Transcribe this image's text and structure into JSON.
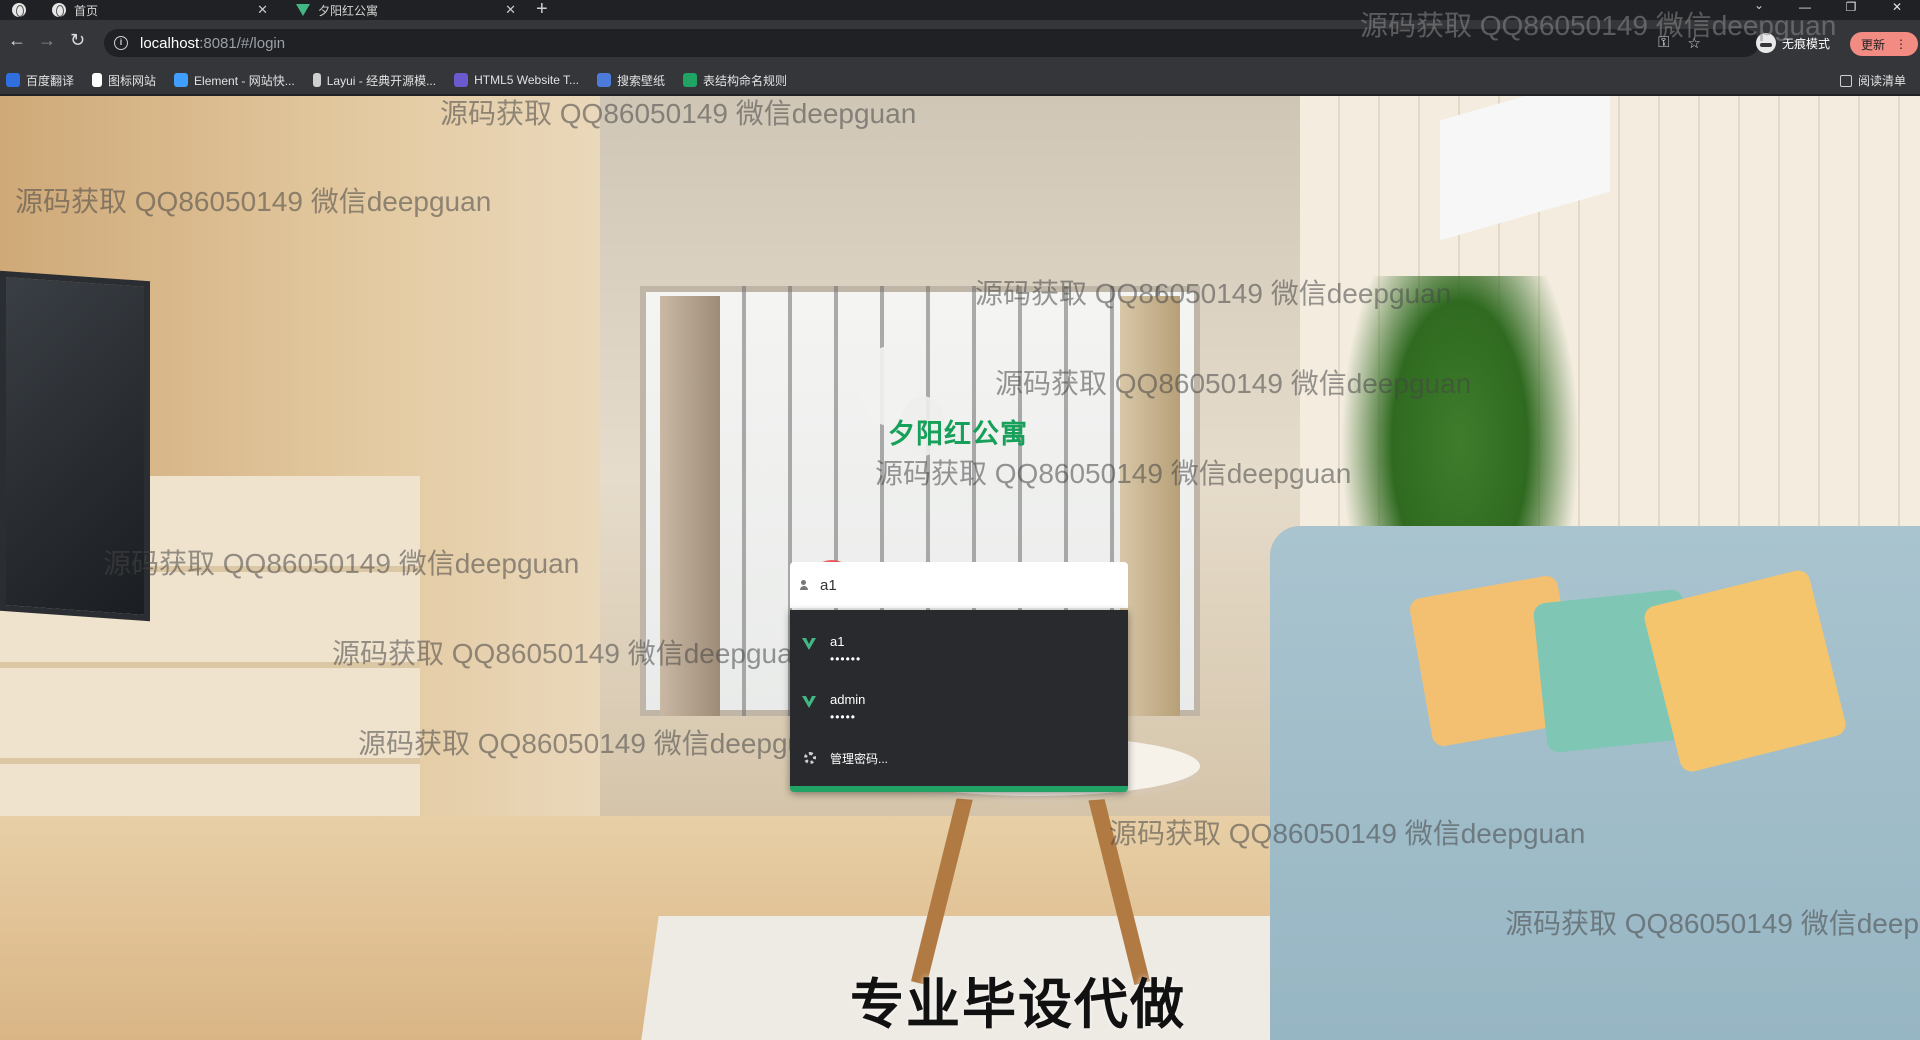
{
  "browser": {
    "tabs": [
      {
        "title": "首页",
        "active": false
      },
      {
        "title": "夕阳红公寓",
        "active": true
      }
    ],
    "new_tab_symbol": "+",
    "url_host": "localhost",
    "url_rest": ":8081/#/login",
    "profile_label": "无痕模式",
    "update_label": "更新",
    "more_symbol": "⋮",
    "bookmarks": [
      {
        "label": "百度翻译",
        "icon": "translate-icon",
        "color": "#2f6fe0"
      },
      {
        "label": "图标网站",
        "icon": "flag-icon",
        "color": "#ffffff"
      },
      {
        "label": "Element - 网站快...",
        "icon": "element-icon",
        "color": "#409eff"
      },
      {
        "label": "Layui - 经典开源模...",
        "icon": "layui-icon",
        "color": "#cfcfcf"
      },
      {
        "label": "HTML5 Website T...",
        "icon": "html5-icon",
        "color": "#6a5acd"
      },
      {
        "label": "搜索壁纸",
        "icon": "wallpaper-icon",
        "color": "#4c7bd9"
      },
      {
        "label": "表结构命名规则",
        "icon": "sheet-icon",
        "color": "#1fa463"
      }
    ],
    "reading_list_label": "阅读清单",
    "window_controls": [
      "⌄",
      "—",
      "❐",
      "✕"
    ]
  },
  "page": {
    "title": "夕阳红公寓",
    "accent_color": "#17a05a",
    "username_value": "a1",
    "autofill": [
      {
        "username": "a1",
        "password_mask": "••••••"
      },
      {
        "username": "admin",
        "password_mask": "•••••"
      }
    ],
    "manage_passwords_label": "管理密码...",
    "caption": "专业毕设代做",
    "watermark_text": "源码获取 QQ86050149 微信deepguan"
  }
}
